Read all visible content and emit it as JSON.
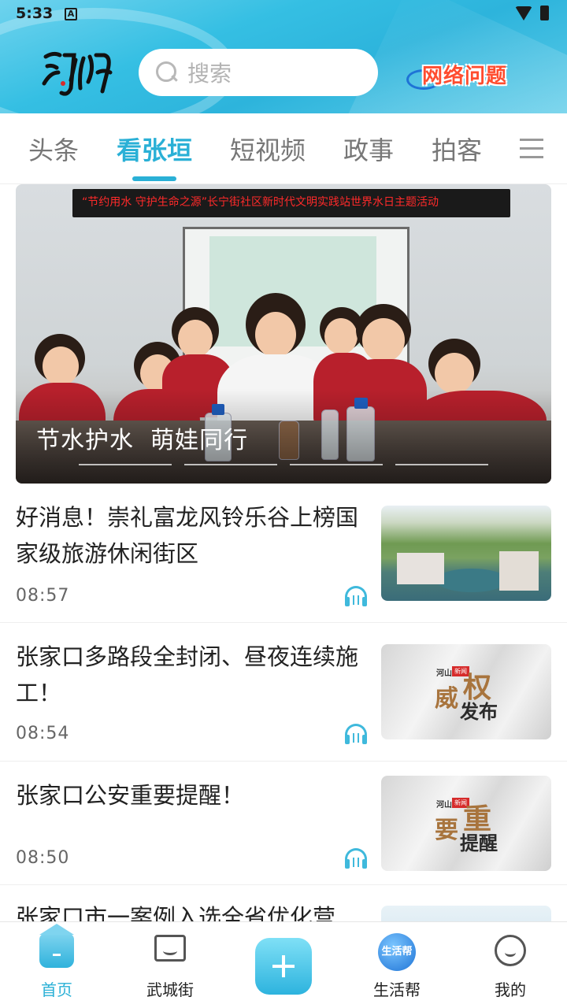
{
  "status_bar": {
    "time": "5:33",
    "app_badge": "A"
  },
  "header": {
    "logo_text": "河山",
    "search_placeholder": "搜索",
    "network_badge": "网络问题"
  },
  "tabs": [
    {
      "label": "头条"
    },
    {
      "label": "看张垣",
      "active": true
    },
    {
      "label": "短视频"
    },
    {
      "label": "政事"
    },
    {
      "label": "拍客"
    }
  ],
  "banner": {
    "sign_text": "“节约用水  守护生命之源”长宁街社区新时代文明实践站世界水日主题活动",
    "caption": "节水护水  萌娃同行",
    "page_count": 4,
    "current_page": 1
  },
  "news": [
    {
      "title": "好消息！崇礼富龙风铃乐谷上榜国家级旅游休闲街区",
      "time": "08:57",
      "thumb": "scenic"
    },
    {
      "title": "张家口多路段全封闭、昼夜连续施工！",
      "time": "08:54",
      "thumb": "authority",
      "thumb_brand": "河山",
      "thumb_tag": "新闻",
      "thumb_big1": "威",
      "thumb_big2": "权",
      "thumb_small": "发布"
    },
    {
      "title": "张家口公安重要提醒！",
      "time": "08:50",
      "thumb": "reminder",
      "thumb_brand": "河山",
      "thumb_tag": "新闻",
      "thumb_big1": "要",
      "thumb_big2": "重",
      "thumb_small": "提醒"
    },
    {
      "title": "张家口市一案例入选全省优化营",
      "time": "",
      "thumb": "coast"
    }
  ],
  "bottom_nav": [
    {
      "label": "首页",
      "active": true
    },
    {
      "label": "武城街"
    },
    {
      "label": ""
    },
    {
      "label": "生活帮",
      "icon_text": "生活帮"
    },
    {
      "label": "我的"
    }
  ],
  "colors": {
    "accent": "#2ab0d6",
    "header_bg": "#35bfe3",
    "text": "#222222",
    "muted": "#666666"
  }
}
